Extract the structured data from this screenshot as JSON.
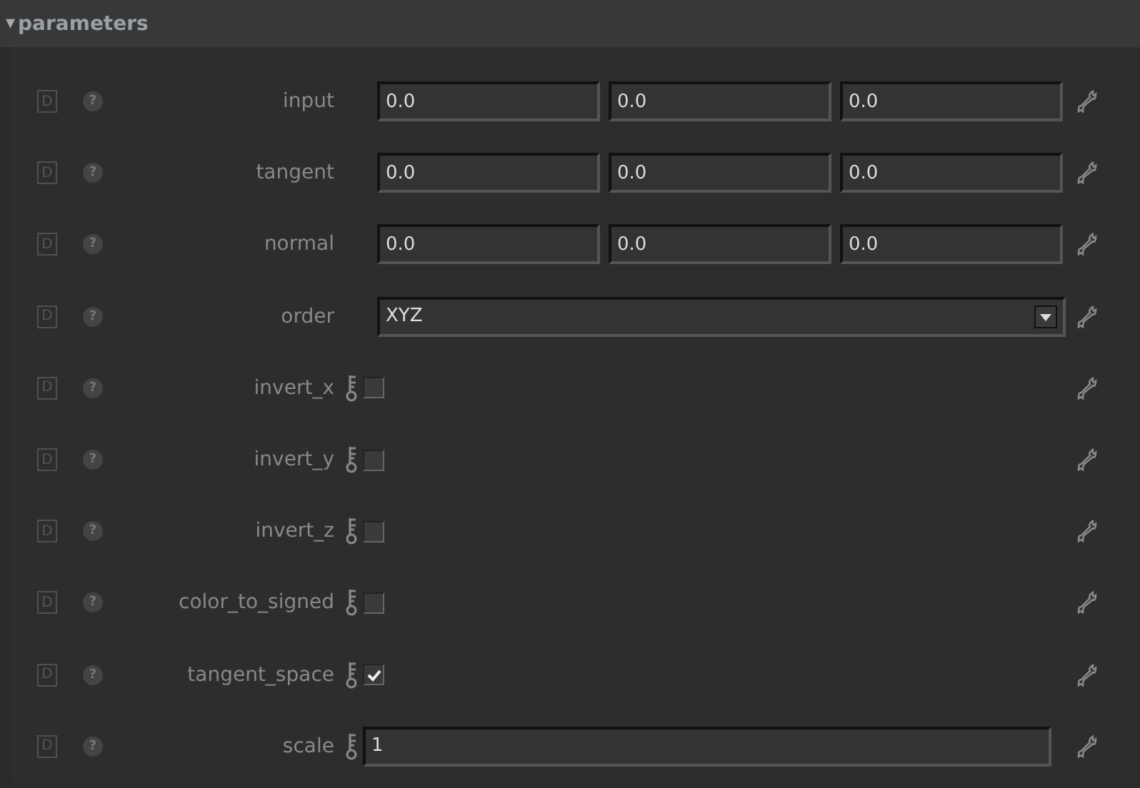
{
  "section": {
    "title": "parameters",
    "expanded": true,
    "arrow": "▾"
  },
  "rows": [
    {
      "kind": "vector",
      "label": "input",
      "default_mark": "D",
      "help_mark": "?",
      "values": [
        "0.0",
        "0.0",
        "0.0"
      ]
    },
    {
      "kind": "vector",
      "label": "tangent",
      "default_mark": "D",
      "help_mark": "?",
      "values": [
        "0.0",
        "0.0",
        "0.0"
      ]
    },
    {
      "kind": "vector",
      "label": "normal",
      "default_mark": "D",
      "help_mark": "?",
      "values": [
        "0.0",
        "0.0",
        "0.0"
      ]
    },
    {
      "kind": "dropdown",
      "label": "order",
      "default_mark": "D",
      "help_mark": "?",
      "value": "XYZ"
    },
    {
      "kind": "checkbox",
      "label": "invert_x",
      "default_mark": "D",
      "help_mark": "?",
      "checked": false
    },
    {
      "kind": "checkbox",
      "label": "invert_y",
      "default_mark": "D",
      "help_mark": "?",
      "checked": false
    },
    {
      "kind": "checkbox",
      "label": "invert_z",
      "default_mark": "D",
      "help_mark": "?",
      "checked": false
    },
    {
      "kind": "checkbox",
      "label": "color_to_signed",
      "default_mark": "D",
      "help_mark": "?",
      "checked": false
    },
    {
      "kind": "checkbox",
      "label": "tangent_space",
      "default_mark": "D",
      "help_mark": "?",
      "checked": true
    },
    {
      "kind": "number",
      "label": "scale",
      "default_mark": "D",
      "help_mark": "?",
      "value": "1"
    }
  ]
}
